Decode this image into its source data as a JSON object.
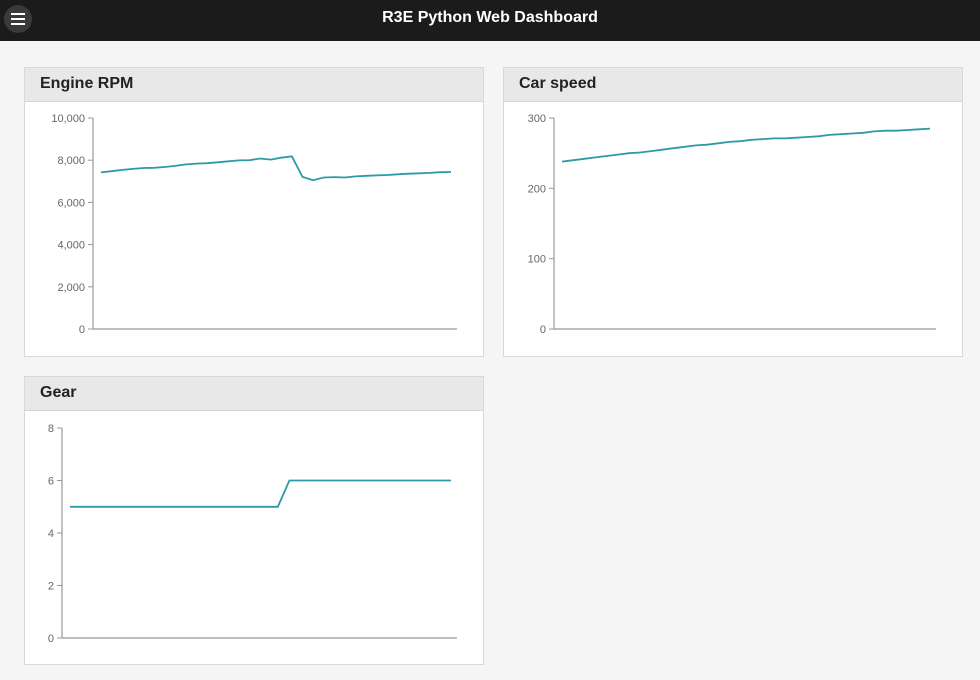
{
  "app": {
    "title": "R3E Python Web Dashboard",
    "menu_icon": "hamburger-menu-icon"
  },
  "colors": {
    "line": "#2e9aa6",
    "axis": "#999999",
    "header_bg": "#1b1b1b",
    "panel_header_bg": "#e8e8e8"
  },
  "panels": [
    {
      "title": "Engine RPM"
    },
    {
      "title": "Car speed"
    },
    {
      "title": "Gear"
    }
  ],
  "chart_data": [
    {
      "type": "line",
      "title": "Engine RPM",
      "ylim": [
        0,
        10000
      ],
      "yticks": [
        "0",
        "2,000",
        "4,000",
        "6,000",
        "8,000",
        "10,000"
      ],
      "ytick_values": [
        0,
        2000,
        4000,
        6000,
        8000,
        10000
      ],
      "x": [
        0,
        1,
        2,
        3,
        4,
        5,
        6,
        7,
        8,
        9,
        10,
        11,
        12,
        13,
        14,
        15,
        16,
        17,
        18,
        19,
        20,
        21,
        22,
        23,
        24,
        25,
        26,
        27,
        28,
        29,
        30,
        31,
        32,
        33
      ],
      "values": [
        7420,
        7480,
        7540,
        7590,
        7630,
        7640,
        7680,
        7730,
        7800,
        7840,
        7860,
        7900,
        7950,
        7990,
        8000,
        8080,
        8030,
        8120,
        8180,
        7210,
        7050,
        7180,
        7200,
        7180,
        7230,
        7260,
        7280,
        7300,
        7330,
        7360,
        7380,
        7400,
        7430,
        7440
      ],
      "grid": false
    },
    {
      "type": "line",
      "title": "Car speed",
      "ylim": [
        0,
        300
      ],
      "yticks": [
        "0",
        "100",
        "200",
        "300"
      ],
      "ytick_values": [
        0,
        100,
        200,
        300
      ],
      "x": [
        0,
        1,
        2,
        3,
        4,
        5,
        6,
        7,
        8,
        9,
        10,
        11,
        12,
        13,
        14,
        15,
        16,
        17,
        18,
        19,
        20,
        21,
        22,
        23,
        24,
        25,
        26,
        27,
        28,
        29,
        30,
        31,
        32,
        33
      ],
      "values": [
        238,
        240,
        242,
        244,
        246,
        248,
        250,
        251,
        253,
        255,
        257,
        259,
        261,
        262,
        264,
        266,
        267,
        269,
        270,
        271,
        271,
        272,
        273,
        274,
        276,
        277,
        278,
        279,
        281,
        282,
        282,
        283,
        284,
        285
      ],
      "grid": false
    },
    {
      "type": "line",
      "title": "Gear",
      "ylim": [
        0,
        8
      ],
      "yticks": [
        "0",
        "2",
        "4",
        "6",
        "8"
      ],
      "ytick_values": [
        0,
        2,
        4,
        6,
        8
      ],
      "x": [
        0,
        1,
        2,
        3,
        4,
        5,
        6,
        7,
        8,
        9,
        10,
        11,
        12,
        13,
        14,
        15,
        16,
        17,
        18,
        19,
        20,
        21,
        22,
        23,
        24,
        25,
        26,
        27,
        28,
        29,
        30,
        31,
        32,
        33
      ],
      "values": [
        5,
        5,
        5,
        5,
        5,
        5,
        5,
        5,
        5,
        5,
        5,
        5,
        5,
        5,
        5,
        5,
        5,
        5,
        5,
        6,
        6,
        6,
        6,
        6,
        6,
        6,
        6,
        6,
        6,
        6,
        6,
        6,
        6,
        6
      ],
      "grid": false
    }
  ]
}
